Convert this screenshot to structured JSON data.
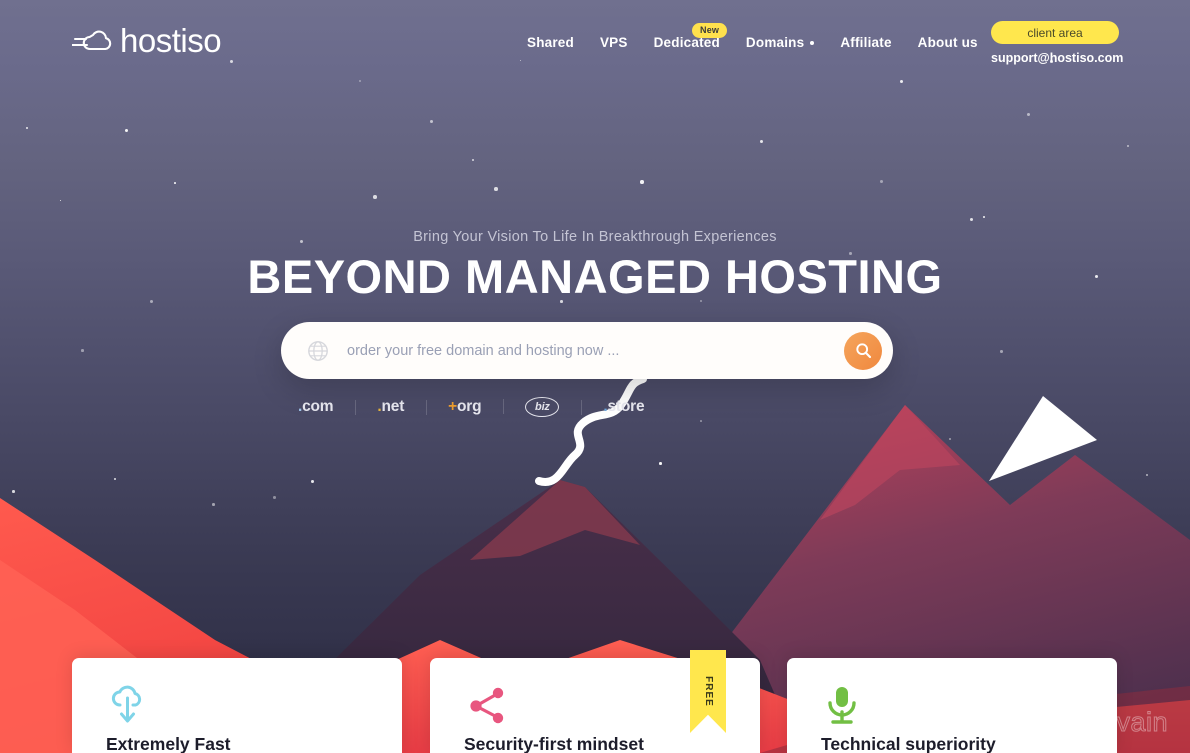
{
  "header": {
    "logo_text": "hostiso",
    "logo_icon": "cloud-wind-icon",
    "nav": [
      {
        "label": "Shared",
        "name": "nav-shared",
        "dot": false
      },
      {
        "label": "VPS",
        "name": "nav-vps",
        "dot": false
      },
      {
        "label": "Dedicated",
        "name": "nav-dedicated",
        "dot": false
      },
      {
        "label": "Domains",
        "name": "nav-domains",
        "dot": true
      },
      {
        "label": "Affiliate",
        "name": "nav-affiliate",
        "dot": false
      },
      {
        "label": "About us",
        "name": "nav-about-us",
        "dot": false
      }
    ],
    "new_badge": "New",
    "client_area_label": "client area",
    "support_email": "support@hostiso.com"
  },
  "hero": {
    "subtitle": "Bring Your Vision To Life In Breakthrough Experiences",
    "headline": "BEYOND MANAGED HOSTING"
  },
  "search": {
    "placeholder": "order your free domain and hosting now ...",
    "value": "",
    "globe_icon": "globe-icon",
    "button_icon": "search-icon"
  },
  "tlds": [
    {
      "dot": ".",
      "name": "com",
      "label": ".com"
    },
    {
      "dot": ".",
      "name": "net",
      "label": ".net"
    },
    {
      "dot": "+",
      "name": "org",
      "label": "+org"
    },
    {
      "dot": "",
      "name": "biz",
      "label": "biz"
    },
    {
      "dot": ".",
      "name": "store",
      "label": "store"
    }
  ],
  "cards": [
    {
      "title": "Extremely Fast",
      "icon": "cloud-download-icon",
      "color": "#7fd4e8",
      "ribbon": null
    },
    {
      "title": "Security-first mindset",
      "icon": "share-nodes-icon",
      "color": "#e8567f",
      "ribbon": "FREE"
    },
    {
      "title": "Technical superiority",
      "icon": "microphone-icon",
      "color": "#72bf44",
      "ribbon": null
    }
  ],
  "watermark": {
    "text": "Revain",
    "icon": "revain-logo-icon"
  },
  "colors": {
    "accent_yellow": "#ffe74d",
    "accent_orange": "#f0883e",
    "sky_top": "#70708f",
    "sky_bottom": "#2c2c42",
    "mountain_red": "#f24a4a",
    "mountain_dark": "#3d2b45"
  }
}
